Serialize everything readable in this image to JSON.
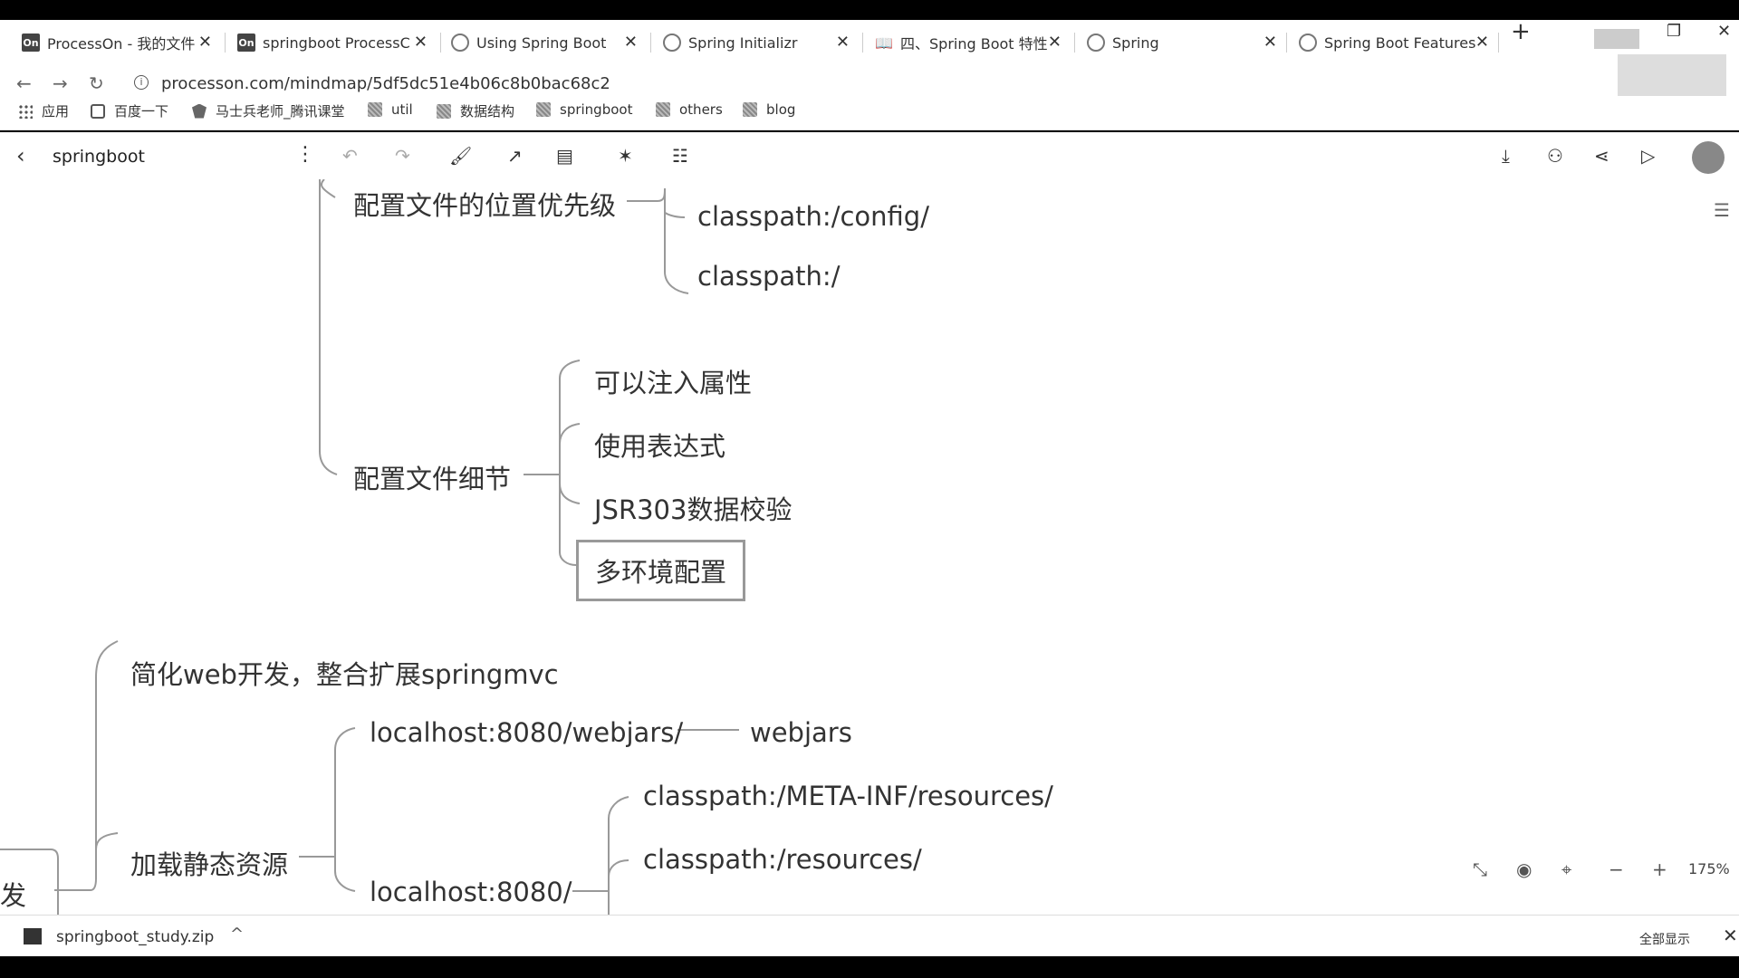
{
  "tabs": [
    {
      "title": "ProcessOn - 我的文件",
      "icon": "processon-icon",
      "favtext": "On"
    },
    {
      "title": "springboot ProcessC",
      "icon": "processon-icon",
      "favtext": "On"
    },
    {
      "title": "Using Spring Boot",
      "icon": "spring-icon",
      "favtext": ""
    },
    {
      "title": "Spring Initializr",
      "icon": "spring-icon",
      "favtext": ""
    },
    {
      "title": "四、Spring Boot 特性",
      "icon": "book-icon",
      "favtext": "📖"
    },
    {
      "title": "Spring",
      "icon": "spring-icon",
      "favtext": ""
    },
    {
      "title": "Spring Boot Features",
      "icon": "spring-icon",
      "favtext": ""
    }
  ],
  "tab_close": "✕",
  "new_tab": "+",
  "address": {
    "url": "processon.com/mindmap/5df5dc51e4b06c8b0bac68c2"
  },
  "bookmarks": [
    {
      "label": "应用",
      "icon": "apps-grid-icon"
    },
    {
      "label": "百度一下",
      "icon": "baidu-icon"
    },
    {
      "label": "马士兵老师_腾讯课堂",
      "icon": "shield-icon"
    },
    {
      "label": "util",
      "icon": "folder-icon"
    },
    {
      "label": "数据结构",
      "icon": "folder-icon"
    },
    {
      "label": "springboot",
      "icon": "folder-icon"
    },
    {
      "label": "others",
      "icon": "folder-icon"
    },
    {
      "label": "blog",
      "icon": "folder-icon"
    }
  ],
  "app": {
    "title": "springboot"
  },
  "mindmap": {
    "nodes": {
      "config_priority": "配置文件的位置优先级",
      "classpath_config": "classpath:/config/",
      "classpath_root": "classpath:/",
      "config_details": "配置文件细节",
      "inject_props": "可以注入属性",
      "use_expr": "使用表达式",
      "jsr303": "JSR303数据校验",
      "multi_env": "多环境配置",
      "simplify_web": "简化web开发，整合扩展springmvc",
      "webjars_url": "localhost:8080/webjars/",
      "webjars": "webjars",
      "meta_inf": "classpath:/META-INF/resources/",
      "resources": "classpath:/resources/",
      "load_static": "加载静态资源",
      "localhost": "localhost:8080/",
      "partial_root": "发"
    }
  },
  "zoom": {
    "percent": "175%"
  },
  "download": {
    "filename": "springboot_study.zip",
    "show_all": "全部显示"
  }
}
